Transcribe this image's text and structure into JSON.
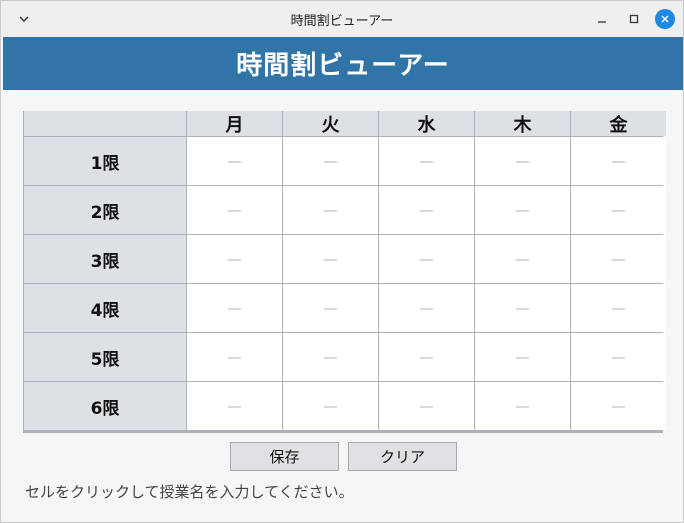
{
  "window": {
    "title": "時間割ビューアー"
  },
  "header": {
    "title": "時間割ビューアー",
    "background": "#3175a8"
  },
  "timetable": {
    "days": [
      "月",
      "火",
      "水",
      "木",
      "金"
    ],
    "periods": [
      "1限",
      "2限",
      "3限",
      "4限",
      "5限",
      "6限"
    ],
    "empty_placeholder": "—"
  },
  "buttons": {
    "save_label": "保存",
    "clear_label": "クリア"
  },
  "hint": "セルをクリックして授業名を入力してください。"
}
